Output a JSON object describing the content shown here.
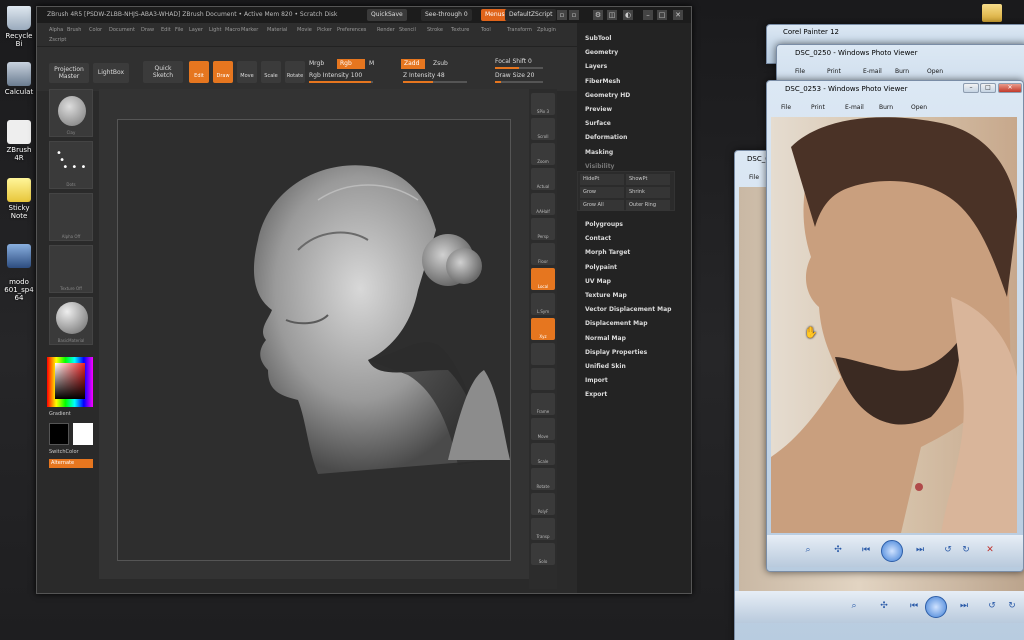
{
  "desktop": {
    "icons": [
      {
        "label": "Recycle Bin",
        "shown": "Recycle Bi"
      },
      {
        "label": "Calculator",
        "shown": "Calculat"
      },
      {
        "label": "ZBrush 4R",
        "shown": "ZBrush 4R"
      },
      {
        "label": "Sticky Notes",
        "shown": "Sticky Note"
      },
      {
        "label": "modo 601_sp4 64",
        "shown": "modo\n601_sp4 64"
      }
    ]
  },
  "zbrush": {
    "title": "ZBrush 4R5 [PSDW-ZLBB-NHJS-ABA3-WHAD]   ZBrush Document   • Active Mem 820 • Scratch Disk",
    "quicksave": "QuickSave",
    "seethrough": "See-through  0",
    "menus_btn": "Menus",
    "default_script": "DefaultZScript",
    "menu_items": [
      "Alpha",
      "Brush",
      "Color",
      "Document",
      "Draw",
      "Edit",
      "File",
      "Layer",
      "Light",
      "Macro",
      "Marker",
      "Material",
      "Movie",
      "Picker",
      "Preferences",
      "Render",
      "Stencil",
      "Stroke",
      "Texture",
      "Tool",
      "Transform",
      "Zplugin",
      "Zscript"
    ],
    "shelf": {
      "projection_master": "Projection\nMaster",
      "lightbox": "LightBox",
      "quick_sketch": "Quick\nSketch",
      "edit": "Edit",
      "draw": "Draw",
      "move": "Move",
      "scale": "Scale",
      "rotate": "Rotate",
      "mrgb": "Mrgb",
      "rgb": "Rgb",
      "m": "M",
      "zadd": "Zadd",
      "zsub": "Zsub",
      "rgb_intensity": "Rgb Intensity 100",
      "z_intensity": "Z Intensity 48",
      "focal_shift": "Focal Shift 0",
      "draw_size": "Draw Size 20"
    },
    "left_thumbs": [
      "Clay",
      "Dots",
      "Alpha Off",
      "Texture Off",
      "BasicMaterial"
    ],
    "gradient_label": "Gradient",
    "switch_color": "SwitchColor",
    "alternate": "Alternate",
    "right_shelf": [
      "SPix 3",
      "Scroll",
      "Zoom",
      "Actual",
      "AAHalf",
      "Persp",
      "Floor",
      "Local",
      "L.Sym",
      "Xyz",
      "",
      "",
      "Frame",
      "Move",
      "Scale",
      "Rotate",
      "PolyF",
      "Transp",
      "Solo"
    ],
    "tray": {
      "items_top": [
        "SubTool",
        "Geometry",
        "Layers",
        "FiberMesh",
        "Geometry HD",
        "Preview",
        "Surface",
        "Deformation",
        "Masking",
        "Visibility"
      ],
      "visibility_buttons": [
        "HidePt",
        "ShowPt",
        "Grow",
        "Shrink",
        "Grow All",
        "Outer Ring"
      ],
      "items_bottom": [
        "Polygroups",
        "Contact",
        "Morph Target",
        "Polypaint",
        "UV Map",
        "Texture Map",
        "Vector Displacement Map",
        "Displacement Map",
        "Normal Map",
        "Display Properties",
        "Unified Skin",
        "Import",
        "Export"
      ]
    }
  },
  "painter": {
    "title": "Corel Painter 12"
  },
  "photo_viewer_back": {
    "title": "DSC_0250 - Windows Photo Viewer",
    "menu": [
      "File",
      "Print",
      "E-mail",
      "Burn",
      "Open"
    ]
  },
  "photo_viewer_front": {
    "title": "DSC_0253 - Windows Photo Viewer",
    "menu": [
      "File",
      "Print",
      "E-mail",
      "Burn",
      "Open"
    ]
  },
  "photo_viewer_third": {
    "title": "DSC_0",
    "menu": [
      "File"
    ]
  },
  "colors": {
    "accent": "#e6761f",
    "zbrush_bg": "#2a2a2a",
    "aero": "#b8cce0"
  }
}
